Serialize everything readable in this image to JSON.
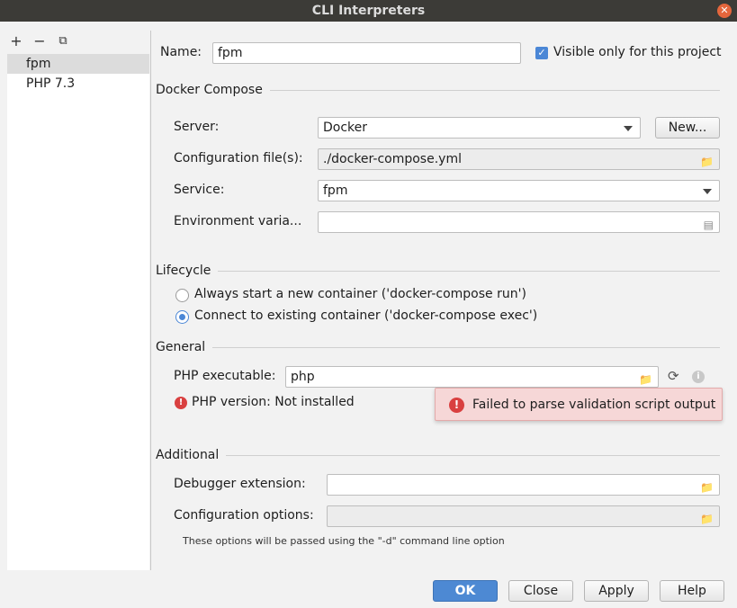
{
  "window": {
    "title": "CLI Interpreters"
  },
  "left_toolbar": {
    "add": "+",
    "remove": "−",
    "copy": "⧉"
  },
  "interpreters": [
    {
      "label": "fpm",
      "selected": true
    },
    {
      "label": "PHP 7.3",
      "selected": false
    }
  ],
  "name": {
    "label": "Name:",
    "value": "fpm"
  },
  "visible_only": {
    "label": "Visible only for this project",
    "checked": true
  },
  "docker_compose": {
    "section": "Docker Compose",
    "server": {
      "label": "Server:",
      "value": "Docker"
    },
    "new_button": "New...",
    "config_files": {
      "label": "Configuration file(s):",
      "value": "./docker-compose.yml"
    },
    "service": {
      "label": "Service:",
      "value": "fpm"
    },
    "env_vars": {
      "label": "Environment varia...",
      "value": ""
    }
  },
  "lifecycle": {
    "section": "Lifecycle",
    "options": [
      {
        "label": "Always start a new container ('docker-compose run')",
        "selected": false
      },
      {
        "label": "Connect to existing container ('docker-compose exec')",
        "selected": true
      }
    ]
  },
  "general": {
    "section": "General",
    "php_executable": {
      "label": "PHP executable:",
      "value": "php"
    },
    "php_version": "PHP version: Not installed"
  },
  "error_popup": {
    "message": "Failed to parse validation script output"
  },
  "additional": {
    "section": "Additional",
    "debugger": {
      "label": "Debugger extension:",
      "value": ""
    },
    "config_options": {
      "label": "Configuration options:",
      "value": ""
    },
    "note": "These options will be passed using the \"-d\" command line option"
  },
  "footer": {
    "ok": "OK",
    "close": "Close",
    "apply": "Apply",
    "help": "Help"
  },
  "colors": {
    "accent": "#4d89d3",
    "error": "#d94040",
    "popup_bg": "#f6d7d7",
    "titlebar": "#3c3b37"
  }
}
